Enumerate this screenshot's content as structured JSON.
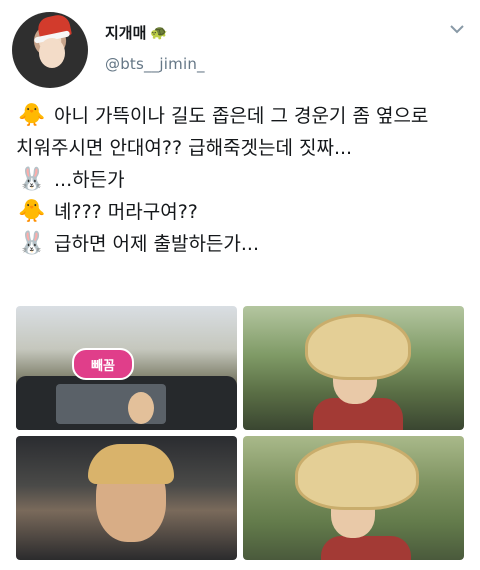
{
  "header": {
    "display_name": "지개매",
    "name_emoji": "🐢",
    "handle": "@bts__jimin_"
  },
  "tweet": {
    "lines": [
      {
        "emoji": "🐥",
        "text": "아니 가뜩이나 길도 좁은데 그 경운기 좀 옆으로"
      },
      {
        "emoji": "",
        "text": "치워주시면 안대여?? 급해죽겟는데 짓짜..."
      },
      {
        "emoji": "🐰",
        "text": "...하든가"
      },
      {
        "emoji": "🐥",
        "text": "녜??? 머라구여??"
      },
      {
        "emoji": "🐰",
        "text": "급하면 어제 출발하든가..."
      }
    ]
  },
  "photos": {
    "tag_text": "빼꼼"
  }
}
